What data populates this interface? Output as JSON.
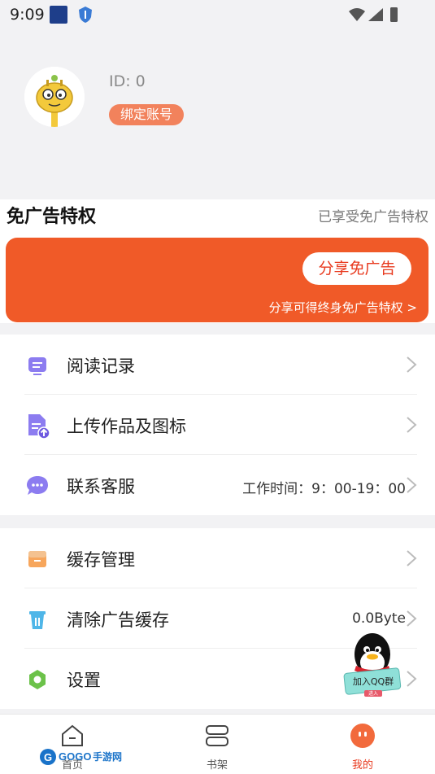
{
  "status": {
    "time": "9:09"
  },
  "profile": {
    "id_text": "ID: 0",
    "bind_label": "绑定账号"
  },
  "ad": {
    "title": "免广告特权",
    "status": "已享受免广告特权",
    "share_button": "分享免广告",
    "share_tip": "分享可得终身免广告特权 >"
  },
  "menu1": [
    {
      "label": "阅读记录",
      "value": ""
    },
    {
      "label": "上传作品及图标",
      "value": ""
    },
    {
      "label": "联系客服",
      "value": "工作时间：9：00-19：00"
    }
  ],
  "menu2": [
    {
      "label": "缓存管理",
      "value": ""
    },
    {
      "label": "清除广告缓存",
      "value": "0.0Byte"
    },
    {
      "label": "设置",
      "value": ""
    }
  ],
  "qq_badge": {
    "label": "加入QQ群",
    "enter": "进入"
  },
  "tabs": [
    {
      "label": "首页"
    },
    {
      "label": "书架"
    },
    {
      "label": "我的"
    }
  ],
  "colors": {
    "accent": "#f05a28",
    "active_tab": "#e8391e"
  }
}
